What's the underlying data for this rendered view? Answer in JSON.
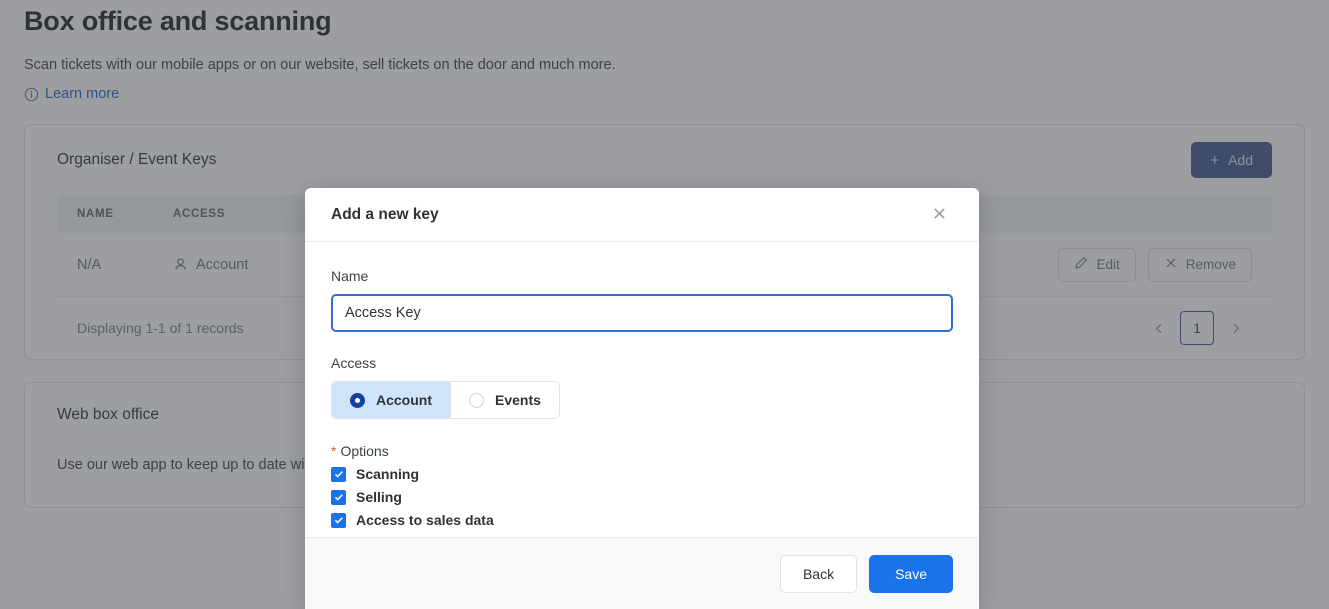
{
  "page": {
    "title": "Box office and scanning",
    "subtitle": "Scan tickets with our mobile apps or on our website, sell tickets on the door and much more.",
    "learn_more": "Learn more",
    "info_icon": "info-icon"
  },
  "keys_card": {
    "title": "Organiser / Event Keys",
    "add_label": "Add",
    "add_icon": "plus-icon",
    "columns": [
      "NAME",
      "ACCESS"
    ],
    "rows": [
      {
        "name": "N/A",
        "access": "Account",
        "access_icon": "user-icon",
        "actions": [
          {
            "label": "Edit",
            "icon": "pencil-icon"
          },
          {
            "label": "Remove",
            "icon": "close-icon"
          }
        ]
      }
    ],
    "records_text": "Displaying 1-1 of 1 records",
    "pagination": {
      "prev_icon": "chevron-left-icon",
      "next_icon": "chevron-right-icon",
      "current_page": "1"
    }
  },
  "web_box_office": {
    "title": "Web box office",
    "text": "Use our web app to keep up to date with your sales, scan tickets on the door, manage guestlists, sell tickets and more."
  },
  "modal": {
    "title": "Add a new key",
    "close_icon": "close-icon",
    "name_label": "Name",
    "name_value": "Access Key",
    "name_placeholder": "Name",
    "access_label": "Access",
    "access_options": [
      {
        "label": "Account",
        "selected": true
      },
      {
        "label": "Events",
        "selected": false
      }
    ],
    "options_label": "Options",
    "required_marker": "*",
    "checkboxes": [
      {
        "label": "Scanning",
        "checked": true
      },
      {
        "label": "Selling",
        "checked": true
      },
      {
        "label": "Access to sales data",
        "checked": true
      }
    ],
    "back_label": "Back",
    "save_label": "Save"
  },
  "colors": {
    "primary_blue": "#1a73e8",
    "link_blue": "#2f6fd0",
    "radio_selected_bg": "#cfe3fb",
    "radio_dot": "#11429e",
    "required_red": "#e0544a",
    "add_button": "#4d6596"
  }
}
